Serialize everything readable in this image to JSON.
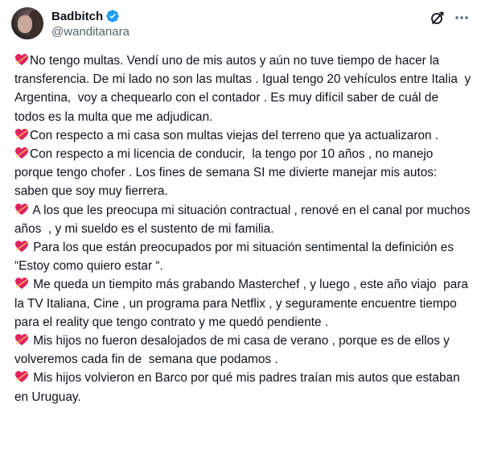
{
  "author": {
    "display_name": "Badbitch",
    "handle": "@wanditanara",
    "verified_color": "#1d9bf0"
  },
  "icons": {
    "verified": "verified-badge-icon",
    "grok": "grok-icon",
    "more": "more-dots-icon",
    "paragraph_marker": "heart-arrow-emoji-icon",
    "heart_color": "#e0245e"
  },
  "tweet": {
    "paragraphs": [
      "No tengo multas. Vendí uno de mis autos y aún no tuve tiempo de hacer la transferencia. De mi lado no son las multas . Igual tengo 20 vehículos entre Italia  y Argentina,  voy a chequearlo con el contador . Es muy difícil saber de cuál de todos es la multa que me adjudican.",
      "Con respecto a mi casa son multas viejas del terreno que ya actualizaron .",
      "Con respecto a mi licencia de conducir,  la tengo por 10 años , no manejo porque tengo chofer . Los fines de semana SI me divierte manejar mis autos: saben que soy muy fierrera.",
      " A los que les preocupa mi situación contractual , renové en el canal por muchos años  , y mi sueldo es el sustento de mi familia.",
      " Para los que están preocupados por mi situación sentimental la definición es “Estoy como quiero estar “.",
      " Me queda un tiempito más grabando Masterchef , y luego , este año viajo  para la TV Italiana, Cine , un programa para Netflix , y seguramente encuentre tiempo para el reality que tengo contrato y me quedó pendiente .",
      " Mis hijos no fueron desalojados de mi casa de verano , porque es de ellos y volveremos cada fin de  semana que podamos .",
      " Mis hijos volvieron en Barco por qué mis padres traían mis autos que estaban en Uruguay."
    ]
  }
}
